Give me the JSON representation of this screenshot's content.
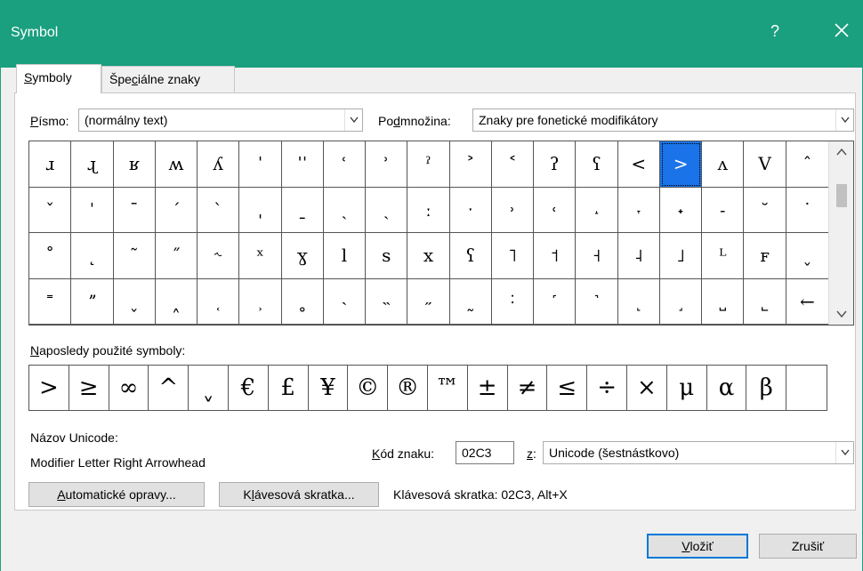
{
  "window": {
    "title": "Symbol",
    "help": "?"
  },
  "tabs": [
    {
      "label_pre": "",
      "label_u": "S",
      "label_post": "ymboly"
    },
    {
      "label_pre": "Špe",
      "label_u": "c",
      "label_post": "iálne znaky"
    }
  ],
  "font_field": {
    "label_u": "P",
    "label_post": "ísmo:",
    "value": "(normálny text)"
  },
  "subset_field": {
    "label_pre": "Po",
    "label_u": "d",
    "label_post": "množina:",
    "value": "Znaky pre fonetické modifikátory"
  },
  "symbols": [
    "ɹ",
    "ɻ",
    "ʁ",
    "ʍ",
    "ʎ",
    "ˈ",
    "ˈˈ",
    "ʿ",
    "ʾ",
    "ˀ",
    "˃",
    "˂",
    "ʔ",
    "ʕ",
    "<",
    ">",
    "ʌ",
    "V",
    "ˆ",
    "ˇ",
    "ˈ",
    "ˉ",
    "ˊ",
    "ˋ",
    "ˌ",
    "ˍ",
    "ˏ",
    "ˎ",
    "ː",
    "ˑ",
    "˒",
    "˓",
    "˔",
    "˕",
    "˖",
    "˗",
    "˘",
    "˙",
    "˚",
    "˛",
    "˜",
    "˝",
    "˞",
    "ˣ",
    "ɣ",
    "l",
    "s",
    "x",
    "ʕ",
    "˥",
    "˦",
    "˧",
    "˨",
    "˩",
    "ᴸ",
    "ꜰ",
    "˯",
    "˭",
    "ˮ",
    "˯",
    "˰",
    "˱",
    "˲",
    "˳",
    "˴",
    "˵",
    "˶",
    "˷",
    "˸",
    "˹",
    "˺",
    "˻",
    "˼",
    "˽",
    "˾",
    "←"
  ],
  "selected_index": 15,
  "recent": {
    "label_u": "N",
    "label_post": "aposledy použité symboly:",
    "items": [
      ">",
      "≥",
      "∞",
      "^",
      "ˬ",
      "€",
      "£",
      "¥",
      "©",
      "®",
      "™",
      "±",
      "≠",
      "≤",
      "÷",
      "×",
      "μ",
      "α",
      "β",
      ""
    ]
  },
  "unicode_name": {
    "label": "Názov Unicode:",
    "value": "Modifier Letter Right Arrowhead"
  },
  "char_code": {
    "label_u": "K",
    "label_post": "ód znaku:",
    "value": "02C3"
  },
  "from_field": {
    "label_u": "z",
    "label_post": ":",
    "value": "Unicode (šestnástkovo)"
  },
  "autocorrect_button": {
    "label_u": "A",
    "label_post": "utomatické opravy..."
  },
  "shortcut_button": {
    "label_pre": "K",
    "label_u": "l",
    "label_post": "ávesová skratka..."
  },
  "shortcut_text": "Klávesová skratka: 02C3, Alt+X",
  "insert_button": {
    "label_u": "V",
    "label_post": "ložiť"
  },
  "cancel_button": {
    "label": "Zrušiť"
  },
  "colors": {
    "titlebar": "#1a9f7f",
    "selection": "#1a73e8"
  }
}
